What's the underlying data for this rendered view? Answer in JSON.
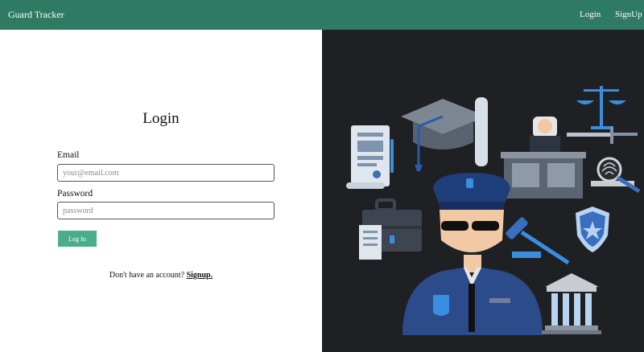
{
  "navbar": {
    "brand": "Guard Tracker",
    "login": "Login",
    "signup": "SignUp"
  },
  "form": {
    "title": "Login",
    "email_label": "Email",
    "email_placeholder": "your@email.com",
    "password_label": "Password",
    "password_placeholder": "password",
    "submit_label": "Log In",
    "signup_prompt": "Don't have an account?",
    "signup_link": "Signup."
  },
  "colors": {
    "navbar": "#2f7a62",
    "button": "#4aae8c",
    "illustration_bg": "#1f2023"
  },
  "illustration": {
    "name": "security-guard-law-illustration"
  }
}
